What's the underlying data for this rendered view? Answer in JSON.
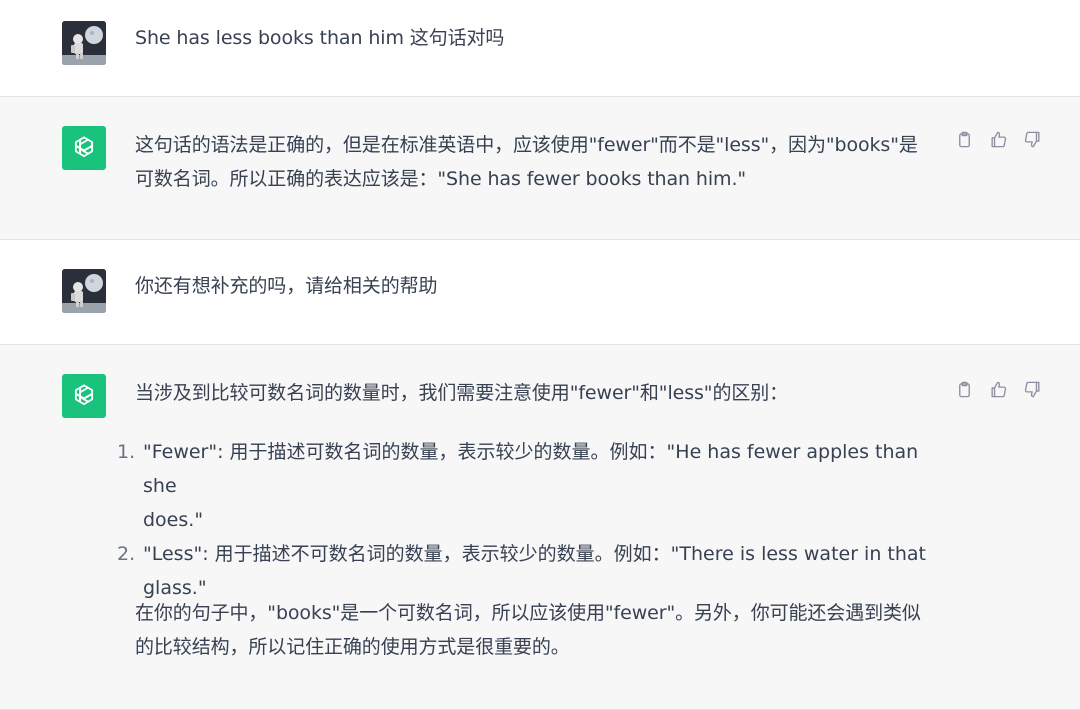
{
  "messages": [
    {
      "role": "user",
      "text": "She has less books than him 这句话对吗"
    },
    {
      "role": "assistant",
      "lines": [
        "这句话的语法是正确的，但是在标准英语中，应该使用\"fewer\"而不是\"less\"，因为\"books\"是",
        "可数名词。所以正确的表达应该是：\"She has fewer books than him.\""
      ]
    },
    {
      "role": "user",
      "text": "你还有想补充的吗，请给相关的帮助"
    },
    {
      "role": "assistant",
      "intro": "当涉及到比较可数名词的数量时，我们需要注意使用\"fewer\"和\"less\"的区别：",
      "points": [
        {
          "num": "1.",
          "lines": [
            "\"Fewer\": 用于描述可数名词的数量，表示较少的数量。例如：\"He has fewer apples than she",
            "does.\""
          ]
        },
        {
          "num": "2.",
          "lines": [
            "\"Less\": 用于描述不可数名词的数量，表示较少的数量。例如：\"There is less water in that",
            "glass.\""
          ]
        }
      ],
      "outro": [
        "在你的句子中，\"books\"是一个可数名词，所以应该使用\"fewer\"。另外，你可能还会遇到类似",
        "的比较结构，所以记住正确的使用方式是很重要的。"
      ]
    }
  ],
  "colors": {
    "assistant_avatar": "#19c37d",
    "assistant_bg": "#f7f7f8",
    "text": "#374151",
    "icon": "#8e8ea0"
  },
  "icons": [
    "copy-icon",
    "thumbs-up-icon",
    "thumbs-down-icon",
    "openai-logo-icon"
  ]
}
